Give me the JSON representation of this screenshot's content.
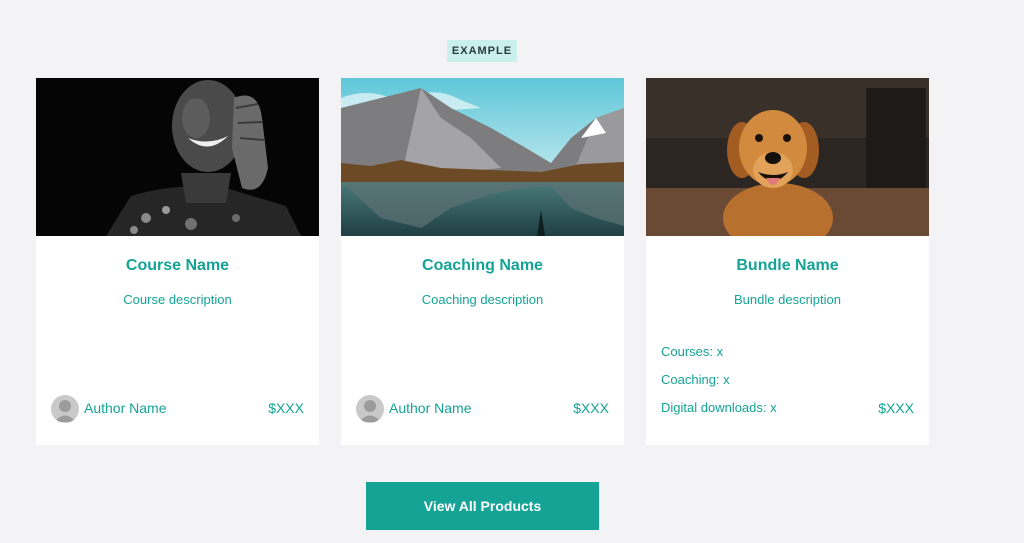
{
  "section": {
    "badge": "EXAMPLE"
  },
  "cards": [
    {
      "image": "person-laughing-photo",
      "title": "Course Name",
      "description": "Course description",
      "author": "Author Name",
      "price": "$XXX"
    },
    {
      "image": "mountain-lake-photo",
      "title": "Coaching Name",
      "description": "Coaching description",
      "author": "Author Name",
      "price": "$XXX"
    },
    {
      "image": "golden-retriever-photo",
      "title": "Bundle Name",
      "description": "Bundle description",
      "contents": [
        "Courses: x",
        "Coaching: x",
        "Digital downloads: x"
      ],
      "price": "$XXX"
    }
  ],
  "cta": {
    "label": "View All Products"
  },
  "colors": {
    "accent": "#14a395",
    "badge_bg": "#c9f0ec",
    "page_bg": "#f3f3f5",
    "card_bg": "#ffffff"
  }
}
